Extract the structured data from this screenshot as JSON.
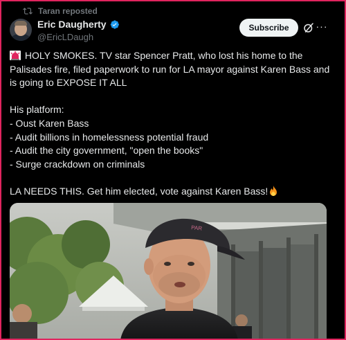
{
  "repost": {
    "label": "Taran reposted"
  },
  "author": {
    "name": "Eric Daugherty",
    "handle": "@EricLDaugh"
  },
  "actions": {
    "subscribe_label": "Subscribe",
    "more_label": "···"
  },
  "tweet": {
    "line1": "HOLY SMOKES. TV star Spencer Pratt, who lost his home to the Palisades fire, filed paperwork to run for LA mayor against Karen Bass and is going to EXPOSE IT ALL",
    "platform_heading": "His platform:",
    "platform_items": [
      "- Oust Karen Bass",
      "- Audit billions in homelessness potential fraud",
      "- Audit the city government, \"open the books\"",
      "- Surge crackdown on criminals"
    ],
    "closing": "LA NEEDS THIS. Get him elected, vote against Karen Bass!"
  },
  "colors": {
    "accent": "#1d9bf0",
    "frame": "#e0245e",
    "muted": "#71767b",
    "text": "#e7e9ea"
  },
  "icons": [
    "repost-icon",
    "verified-icon",
    "grok-icon",
    "more-icon",
    "siren-emoji",
    "fire-emoji"
  ]
}
